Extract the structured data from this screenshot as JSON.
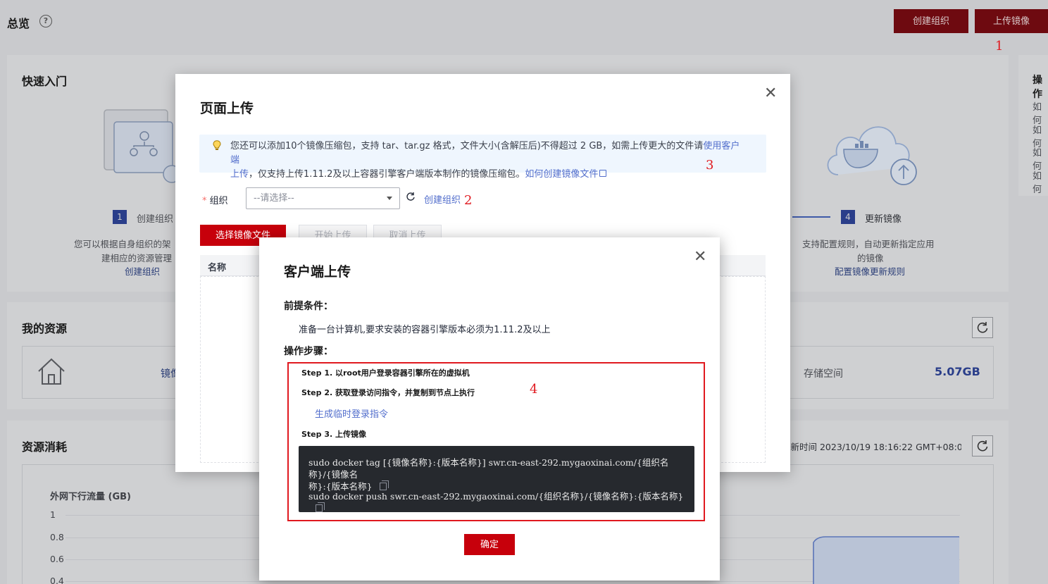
{
  "header": {
    "title": "总览",
    "help_icon": "?",
    "create_org_button": "创建组织",
    "upload_image_button": "上传镜像",
    "annotation_1": "1"
  },
  "quickstart": {
    "title": "快速入门",
    "step1": {
      "num": "1",
      "label": "创建组织",
      "desc_line1": "您可以根据自身组织的架",
      "desc_line2": "建相应的资源管理",
      "link": "创建组织"
    },
    "step4": {
      "num": "4",
      "label": "更新镜像",
      "desc_line1": "支持配置规则，自动更新指定应用",
      "desc_line2": "的镜像",
      "link": "配置镜像更新规则"
    }
  },
  "ops_panel": {
    "title": "操作",
    "items": [
      "如何",
      "如何",
      "如何",
      "如何"
    ]
  },
  "my_resources": {
    "title": "我的资源",
    "left_label": "镜像",
    "storage_label": "存储空间",
    "storage_value": "5.07GB"
  },
  "consumption": {
    "title": "资源消耗",
    "refresh_time": "刷新时间 2023/10/19 18:16:22 GMT+08:00",
    "chart_title": "外网下行流量 (GB)",
    "y_ticks": [
      "1",
      "0.8",
      "0.6",
      "0.4"
    ]
  },
  "chart_data": {
    "type": "line",
    "title": "外网下行流量 (GB)",
    "y_ticks": [
      1,
      0.8,
      0.6,
      0.4
    ],
    "series": [
      {
        "values": [
          0,
          0,
          0,
          0,
          0.92,
          0.92,
          0.92
        ]
      }
    ]
  },
  "upload_modal": {
    "title": "页面上传",
    "tip_text": "您还可以添加10个镜像压缩包，支持 tar、tar.gz 格式，文件大小(含解压后)不得超过 2 GB，如需上传更大的文件请",
    "tip_link1_a": "使用客户端",
    "tip_link1_b": "上传",
    "tip_text2": "，仅支持上传1.11.2及以上容器引擎客户端版本制作的镜像压缩包。",
    "tip_link2": "如何创建镜像文件",
    "annotation_3": "3",
    "org_label": "组织",
    "org_placeholder": "--请选择--",
    "create_org_link": "创建组织",
    "annotation_2": "2",
    "select_file_button": "选择镜像文件",
    "start_upload_button": "开始上传",
    "cancel_upload_button": "取消上传",
    "table_header_name": "名称"
  },
  "client_modal": {
    "title": "客户端上传",
    "prereq_title": "前提条件：",
    "prereq_text": "准备一台计算机,要求安装的容器引擎版本必须为1.11.2及以上",
    "steps_title": "操作步骤：",
    "step1": "Step 1. 以root用户登录容器引擎所在的虚拟机",
    "step2": "Step 2. 获取登录访问指令，并复制到节点上执行",
    "gen_link": "生成临时登录指令",
    "step3": "Step 3. 上传镜像",
    "cmd1_line1": "sudo docker tag [{镜像名称}:{版本名称}] swr.cn-east-292.mygaoxinai.com/{组织名称}/{镜像名",
    "cmd1_line2": "称}:{版本名称}",
    "cmd2": "sudo docker push swr.cn-east-292.mygaoxinai.com/{组织名称}/{镜像名称}:{版本名称}",
    "annotation_4": "4",
    "confirm_button": "确定"
  }
}
